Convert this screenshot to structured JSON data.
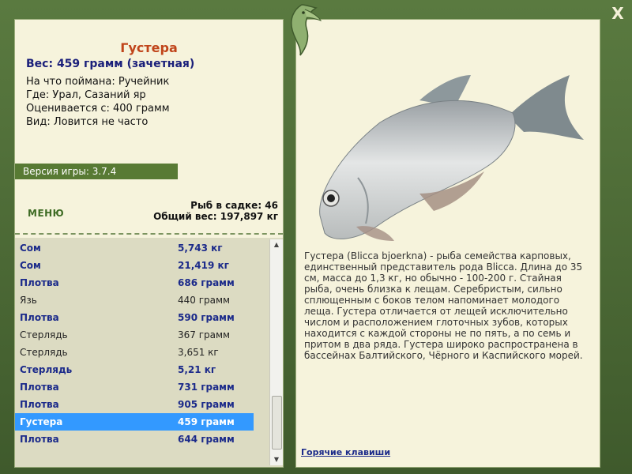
{
  "window": {
    "close_glyph": "X"
  },
  "fish": {
    "title": "Густера",
    "weight_line": "Вес: 459 грамм (зачетная)",
    "caught_on": "На что поймана: Ручейник",
    "location": "Где: Урал, Сазаний яр",
    "valued_from": "Оценивается с: 400 грамм",
    "frequency": "Вид: Ловится не часто"
  },
  "version": "Версия игры: 3.7.4",
  "menu_label": "МЕНЮ",
  "stats": {
    "fish_count": "Рыб в садке: 46",
    "total_weight": "Общий вес: 197,897 кг"
  },
  "catch_list": [
    {
      "name": "Сом",
      "weight": "5,743 кг",
      "style": "bold"
    },
    {
      "name": "Сом",
      "weight": "21,419 кг",
      "style": "bold"
    },
    {
      "name": "Плотва",
      "weight": "686 грамм",
      "style": "bold"
    },
    {
      "name": "Язь",
      "weight": "440 грамм",
      "style": "plain"
    },
    {
      "name": "Плотва",
      "weight": "590 грамм",
      "style": "bold"
    },
    {
      "name": "Стерлядь",
      "weight": "367 грамм",
      "style": "plain"
    },
    {
      "name": "Стерлядь",
      "weight": "3,651 кг",
      "style": "plain"
    },
    {
      "name": "Стерлядь",
      "weight": "5,21 кг",
      "style": "bold"
    },
    {
      "name": "Плотва",
      "weight": "731 грамм",
      "style": "bold"
    },
    {
      "name": "Плотва",
      "weight": "905 грамм",
      "style": "bold"
    },
    {
      "name": "Густера",
      "weight": "459 грамм",
      "style": "sel"
    },
    {
      "name": "Плотва",
      "weight": "644 грамм",
      "style": "bold"
    }
  ],
  "description": "Густера (Blicca bjoerkna) - рыба семейства карповых, единственный представитель рода Blicca. Длина до 35 см, масса до 1,3 кг, но обычно - 100-200 г. Стайная рыба, очень близка к лещам. Серебристым, сильно сплющенным с боков телом напоминает молодого леща. Густера отличается от лещей исключительно числом и расположением глоточных зубов, которых находится с каждой стороны не по пять, а по семь и притом в два ряда. Густера широко распространена в бассейнах Балтийского, Чёрного и Каспийского морей.",
  "hotkeys_label": "Горячие клавиши",
  "colors": {
    "frame": "#4d6b36",
    "panel": "#f6f3dc",
    "title": "#c0441a",
    "navy": "#1b2a8a",
    "selected": "#3399ff"
  }
}
